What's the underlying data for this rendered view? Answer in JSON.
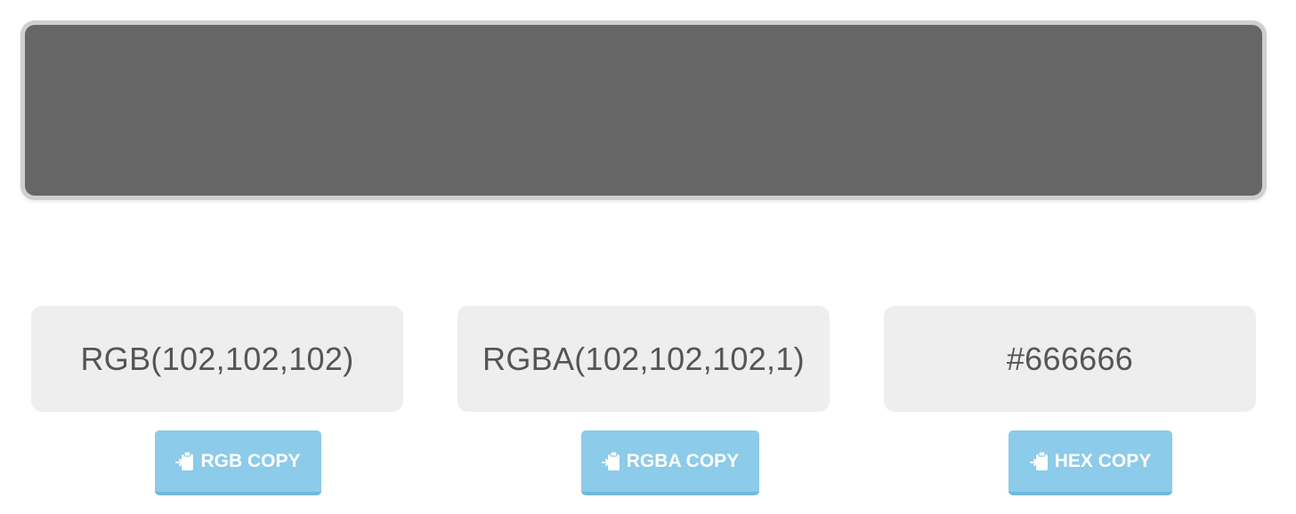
{
  "swatch": {
    "color": "#666666"
  },
  "values": {
    "rgb": "RGB(102,102,102)",
    "rgba": "RGBA(102,102,102,1)",
    "hex": "#666666"
  },
  "buttons": {
    "rgb_copy": "RGB COPY",
    "rgba_copy": "RGBA COPY",
    "hex_copy": "HEX COPY",
    "icon": "clipboard-paste-icon"
  },
  "colors": {
    "button_bg": "#8ccbe9",
    "value_bg": "#eeeeee",
    "text": "#555555"
  }
}
